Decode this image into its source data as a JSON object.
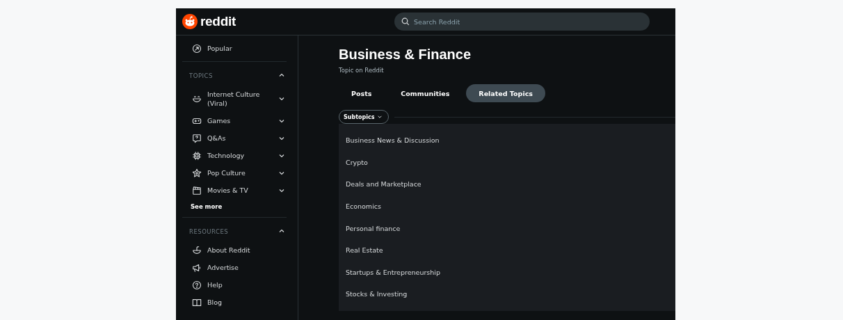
{
  "header": {
    "logo_text": "reddit",
    "search": {
      "placeholder": "Search Reddit"
    }
  },
  "sidebar": {
    "top_items": [
      {
        "label": "Popular"
      }
    ],
    "sections": [
      {
        "heading": "TOPICS",
        "expanded": true,
        "items": [
          {
            "label": "Internet Culture (Viral)",
            "expandable": true
          },
          {
            "label": "Games",
            "expandable": true
          },
          {
            "label": "Q&As",
            "expandable": true
          },
          {
            "label": "Technology",
            "expandable": true
          },
          {
            "label": "Pop Culture",
            "expandable": true
          },
          {
            "label": "Movies & TV",
            "expandable": true
          }
        ],
        "see_more": "See more"
      },
      {
        "heading": "RESOURCES",
        "expanded": true,
        "items": [
          {
            "label": "About Reddit",
            "expandable": false
          },
          {
            "label": "Advertise",
            "expandable": false
          },
          {
            "label": "Help",
            "expandable": false
          },
          {
            "label": "Blog",
            "expandable": false
          }
        ]
      }
    ]
  },
  "main": {
    "title": "Business & Finance",
    "subtitle": "Topic on Reddit",
    "tabs": [
      {
        "label": "Posts",
        "selected": false
      },
      {
        "label": "Communities",
        "selected": false
      },
      {
        "label": "Related Topics",
        "selected": true
      }
    ],
    "filter": {
      "label": "Subtopics"
    },
    "subtopics": [
      "Business News & Discussion",
      "Crypto",
      "Deals and Marketplace",
      "Economics",
      "Personal finance",
      "Real Estate",
      "Startups & Entrepreneurship",
      "Stocks & Investing"
    ]
  }
}
